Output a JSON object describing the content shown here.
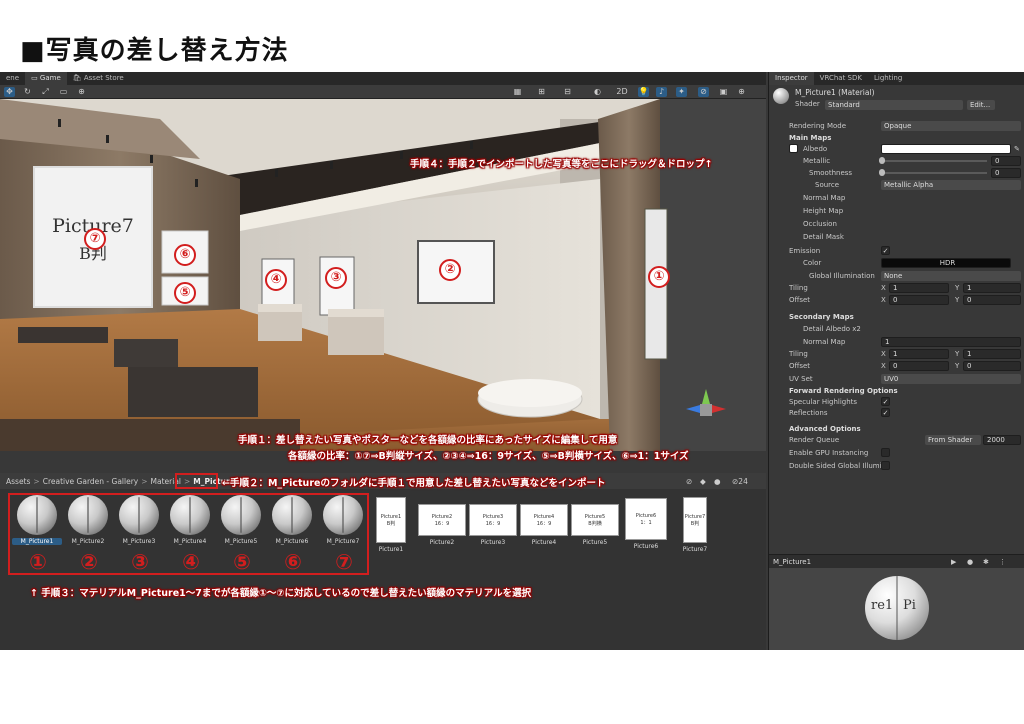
{
  "slide_title": "■写真の差し替え方法",
  "scene_tabs": [
    "ene",
    "Game",
    "Asset Store"
  ],
  "scene_toolbar": {
    "mode_2d": "2D",
    "hidden_count": "24"
  },
  "inspector": {
    "tabs": [
      "Inspector",
      "VRChat SDK",
      "Lighting"
    ],
    "material_name": "M_Picture1 (Material)",
    "shader_label": "Shader",
    "shader_value": "Standard",
    "edit_button": "Edit...",
    "rows": {
      "rendering_mode": {
        "label": "Rendering Mode",
        "value": "Opaque"
      },
      "main_maps": "Main Maps",
      "albedo": "Albedo",
      "metallic": {
        "label": "Metallic",
        "value": "0"
      },
      "smoothness": {
        "label": "Smoothness",
        "value": "0"
      },
      "source": {
        "label": "Source",
        "value": "Metallic Alpha"
      },
      "normal_map": "Normal Map",
      "height_map": "Height Map",
      "occlusion": "Occlusion",
      "detail_mask": "Detail Mask",
      "emission": "Emission",
      "color": "Color",
      "hdr": "HDR",
      "global_illumination": {
        "label": "Global Illumination",
        "value": "None"
      },
      "tiling": {
        "label": "Tiling",
        "x": "1",
        "y": "1"
      },
      "offset": {
        "label": "Offset",
        "x": "0",
        "y": "0"
      },
      "secondary_maps": "Secondary Maps",
      "detail_albedo": "Detail Albedo x2",
      "normal_map2": {
        "label": "Normal Map",
        "value": "1"
      },
      "tiling2": {
        "label": "Tiling",
        "x": "1",
        "y": "1"
      },
      "offset2": {
        "label": "Offset",
        "x": "0",
        "y": "0"
      },
      "uv_set": {
        "label": "UV Set",
        "value": "UV0"
      },
      "forward_rendering": "Forward Rendering Options",
      "specular": "Specular Highlights",
      "reflections": "Reflections",
      "advanced": "Advanced Options",
      "render_queue": {
        "label": "Render Queue",
        "dropdown": "From Shader",
        "value": "2000"
      },
      "gpu_instancing": "Enable GPU Instancing",
      "double_sided": "Double Sided Global Illumin"
    },
    "preview_title": "M_Picture1",
    "preview_text": [
      "re1",
      "Pi"
    ]
  },
  "project": {
    "breadcrumb": [
      "Assets",
      "Creative Garden - Gallery",
      "Material",
      "M_Picture"
    ],
    "materials": [
      "M_Picture1",
      "M_Picture2",
      "M_Picture3",
      "M_Picture4",
      "M_Picture5",
      "M_Picture6",
      "M_Picture7"
    ],
    "textures": [
      {
        "name": "Picture1",
        "thumb": "Picture1",
        "thumb2": "B判"
      },
      {
        "name": "Picture2",
        "thumb": "Picture2",
        "thumb2": "16：9"
      },
      {
        "name": "Picture3",
        "thumb": "Picture3",
        "thumb2": "16：9"
      },
      {
        "name": "Picture4",
        "thumb": "Picture4",
        "thumb2": "16：9"
      },
      {
        "name": "Picture5",
        "thumb": "Picture5",
        "thumb2": "B判横"
      },
      {
        "name": "Picture6",
        "thumb": "Picture6",
        "thumb2": "1：1"
      },
      {
        "name": "Picture7",
        "thumb": "Picture7",
        "thumb2": "B判"
      }
    ]
  },
  "scene_content": {
    "frame7_text1": "Picture7",
    "frame7_text2": "B判"
  },
  "frame_markers": [
    "⑦",
    "⑥",
    "⑤",
    "④",
    "③",
    "②",
    "①"
  ],
  "material_markers": [
    "①",
    "②",
    "③",
    "④",
    "⑤",
    "⑥",
    "⑦"
  ],
  "annotations": {
    "step4": "手順４：手順２でインポートした写真等をここにドラッグ＆ドロップ↑",
    "step1a": "手順１：差し替えたい写真やポスターなどを各額縁の比率にあったサイズに編集して用意",
    "step1b": "各額縁の比率：①⑦⇒B判縦サイズ、②③④⇒16：9サイズ、⑤⇒B判横サイズ、⑥⇒1：1サイズ",
    "step2": "←手順２：M_Pictureのフォルダに手順１で用意した差し替えたい写真などをインポート",
    "step3": "↑ 手順３：マテリアルM_Picture1～7までが各額縁①～⑦に対応しているので差し替えたい額縁のマテリアルを選択"
  },
  "colors": {
    "accent": "#d21e1e",
    "selection": "#2c5d87",
    "editor_bg": "#383838"
  }
}
